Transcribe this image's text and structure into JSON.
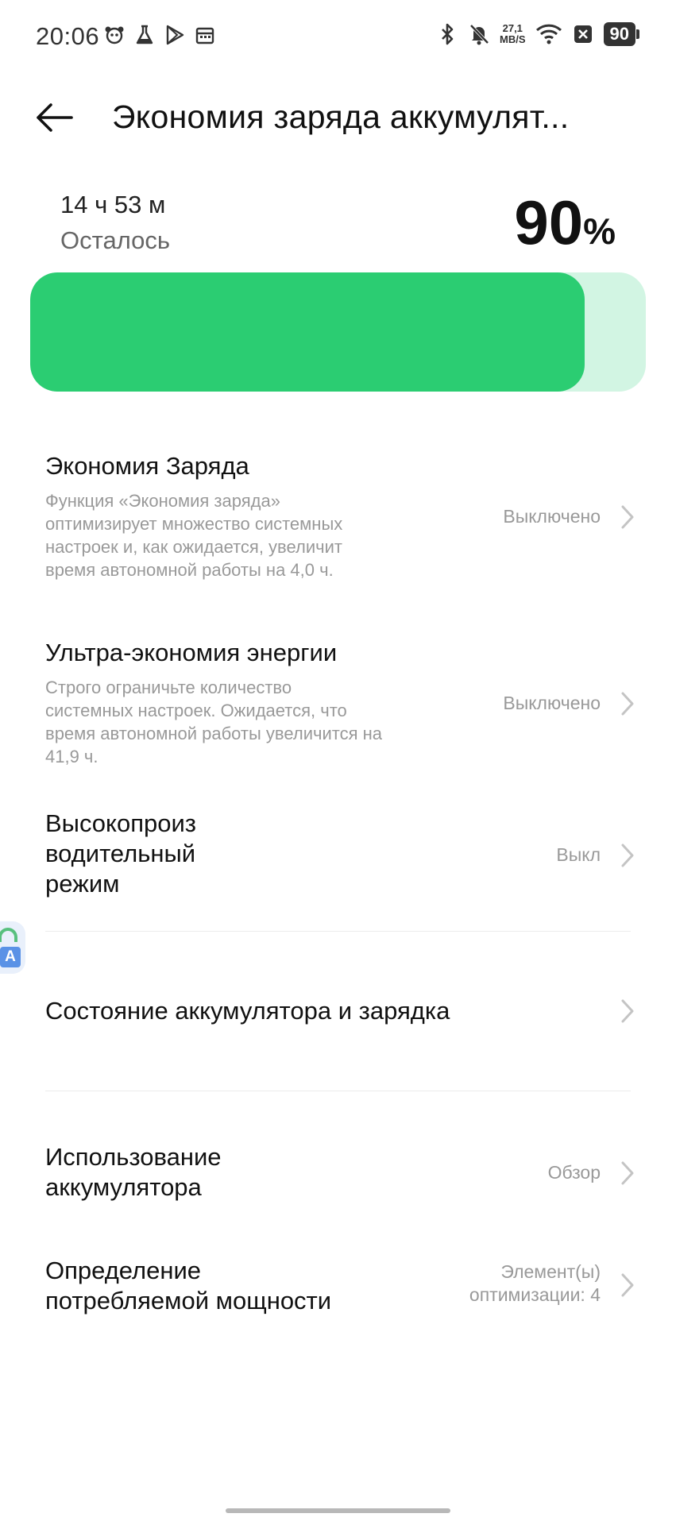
{
  "status_bar": {
    "time": "20:06",
    "net_speed_value": "27,1",
    "net_speed_unit": "MB/S",
    "battery_level": "90",
    "left_icons": [
      "panda-icon",
      "flask-icon",
      "play-store-icon",
      "calendar-icon"
    ],
    "right_icons": [
      "bluetooth-icon",
      "bell-muted-icon",
      "wifi-icon",
      "close-box-icon"
    ]
  },
  "header": {
    "back_icon": "arrow-left-icon",
    "title": "Экономия заряда аккумулят..."
  },
  "battery": {
    "remaining_time": "14 ч 53 м",
    "remaining_label": "Осталось",
    "percent_value": "90",
    "percent_sign": "%",
    "level_fraction": 0.9,
    "fill_color": "#2bcd72",
    "track_color": "#d2f5e3"
  },
  "settings": {
    "power_saving": {
      "title": "Экономия Заряда",
      "desc_lines": [
        "Функция «Экономия заряда»",
        "оптимизирует множество системных",
        "настроек и, как ожидается, увеличит",
        "время автономной работы на 4,0 ч."
      ],
      "value": "Выключено"
    },
    "ultra_saving": {
      "title": "Ультра-экономия энергии",
      "desc_lines": [
        "Строго ограничьте количество",
        "системных настроек. Ожидается, что",
        "время автономной работы увеличится на",
        "41,9 ч."
      ],
      "value": "Выключено"
    },
    "high_performance": {
      "title_lines": [
        "Высокопроиз",
        "водительный",
        "режим"
      ],
      "value": "Выкл"
    },
    "battery_health": {
      "title": "Состояние аккумулятора и зарядка"
    },
    "battery_usage": {
      "title_lines": [
        "Использование",
        "аккумулятора"
      ],
      "value": "Обзор"
    },
    "power_consumption": {
      "title_lines": [
        "Определение",
        "потребляемой мощности"
      ],
      "value_lines": [
        "Элемент(ы)",
        "оптимизации: 4"
      ]
    }
  },
  "floating_translate": {
    "letter": "A",
    "icon": "translate-icon"
  }
}
